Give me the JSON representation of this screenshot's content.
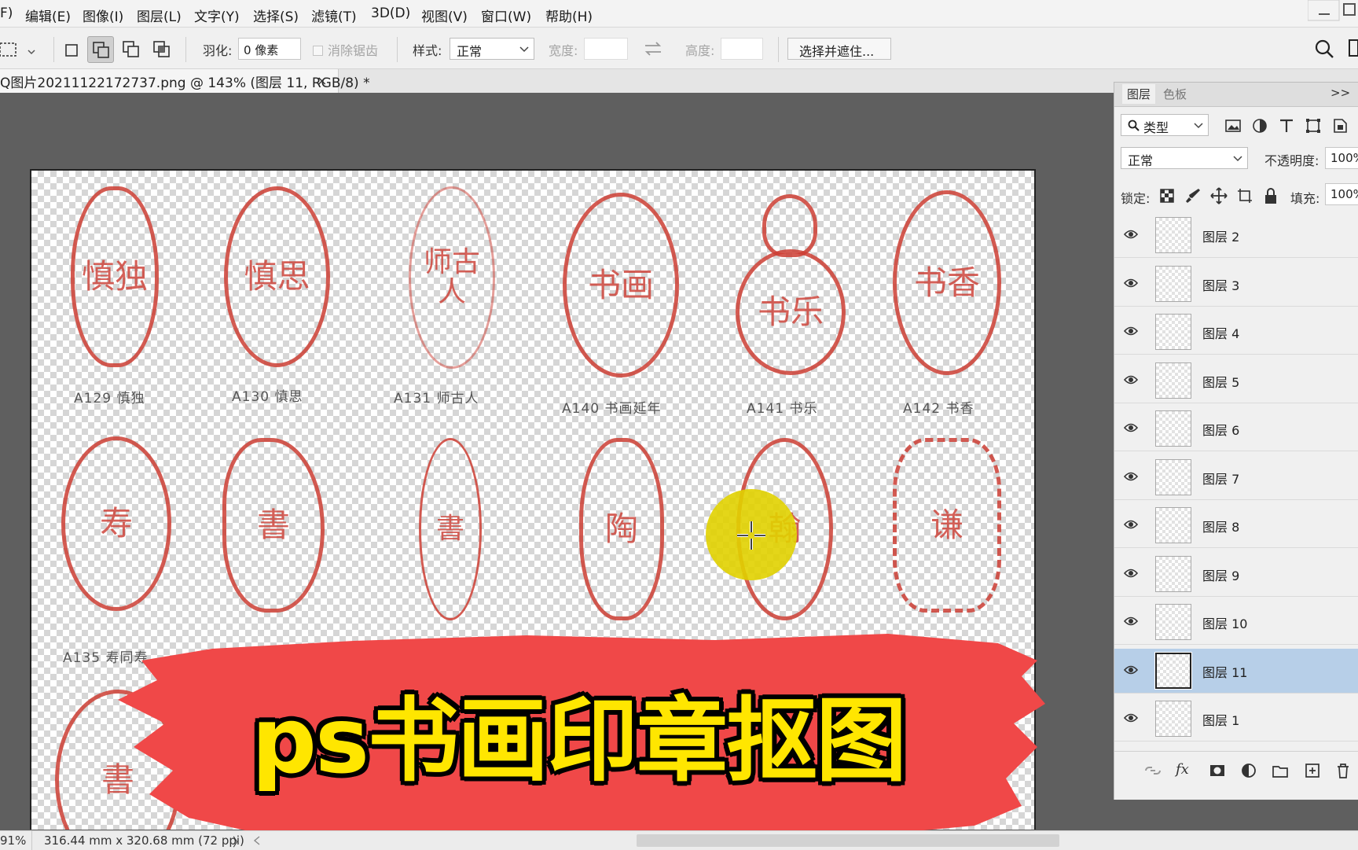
{
  "menu": {
    "items": [
      "F)",
      "编辑(E)",
      "图像(I)",
      "图层(L)",
      "文字(Y)",
      "选择(S)",
      "滤镜(T)",
      "3D(D)",
      "视图(V)",
      "窗口(W)",
      "帮助(H)"
    ]
  },
  "options": {
    "feather_label": "羽化:",
    "feather_value": "0 像素",
    "antialias_label": "消除锯齿",
    "style_label": "样式:",
    "style_value": "正常",
    "width_label": "宽度:",
    "height_label": "高度:",
    "select_mask_button": "选择并遮住..."
  },
  "document": {
    "tab_title": "Q图片20211122172737.png @ 143% (图层 11, RGB/8) *",
    "close_glyph": "×"
  },
  "canvas": {
    "seal_captions": [
      "A129 慎独",
      "A130 慎思",
      "A131 师古人",
      "A140 书画延年",
      "A141 书乐",
      "A142 书香",
      "A135 寿同寿"
    ],
    "seal_glyphs": [
      "慎独",
      "慎思",
      "师古人",
      "书画",
      "书乐",
      "书香",
      "寿",
      "書",
      "書",
      "陶",
      "翰",
      "谦",
      "書"
    ],
    "banner_title": "ps书画印章抠图",
    "banner_color": "#f04848",
    "title_color": "#ffe600"
  },
  "status": {
    "zoom": "91%",
    "doc_size": "316.44 mm x 320.68 mm (72 ppi)",
    "arrow": "〉"
  },
  "layers_panel": {
    "tabs": [
      "图层",
      "色板"
    ],
    "expand_glyph": ">>",
    "filter_label": "类型",
    "blend_mode": "正常",
    "opacity_label": "不透明度:",
    "opacity_value": "100%",
    "lock_label": "锁定:",
    "fill_label": "填充:",
    "fill_value": "100%",
    "layers": [
      {
        "name": "图层 2",
        "selected": false
      },
      {
        "name": "图层 3",
        "selected": false
      },
      {
        "name": "图层 4",
        "selected": false
      },
      {
        "name": "图层 5",
        "selected": false
      },
      {
        "name": "图层 6",
        "selected": false
      },
      {
        "name": "图层 7",
        "selected": false
      },
      {
        "name": "图层 8",
        "selected": false
      },
      {
        "name": "图层 9",
        "selected": false
      },
      {
        "name": "图层 10",
        "selected": false
      },
      {
        "name": "图层 11",
        "selected": true
      },
      {
        "name": "图层 1",
        "selected": false
      }
    ],
    "fx_label": "fx"
  }
}
